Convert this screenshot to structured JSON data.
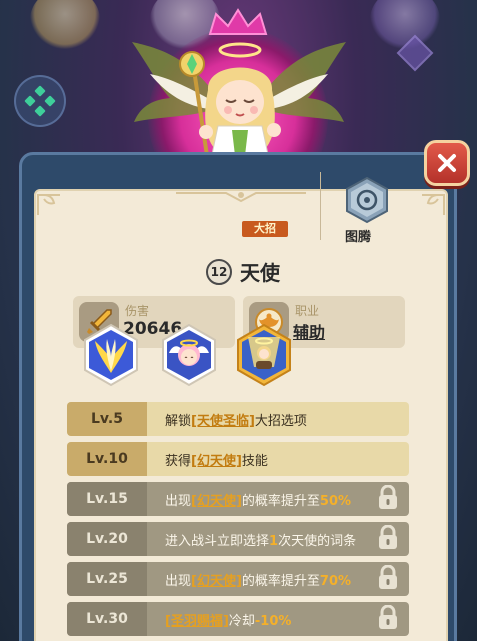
{
  "hero": {
    "level": "12",
    "name": "天使"
  },
  "stats": {
    "damage_label": "伤害",
    "damage_value": "20646",
    "job_label": "职业",
    "job_value": "辅助"
  },
  "skills": {
    "ult_tag": "大招",
    "totem_label": "图腾"
  },
  "levels": [
    {
      "lv": "Lv.5",
      "pre": "解锁",
      "hl": "[天使圣临]",
      "post": "大招选项",
      "num": "",
      "post2": "",
      "locked": false
    },
    {
      "lv": "Lv.10",
      "pre": "获得",
      "hl": "[幻天使]",
      "post": "技能",
      "num": "",
      "post2": "",
      "locked": false
    },
    {
      "lv": "Lv.15",
      "pre": "出现",
      "hl": "[幻天使]",
      "post": "的概率提升至",
      "num": "50%",
      "post2": "",
      "locked": true
    },
    {
      "lv": "Lv.20",
      "pre": "进入战斗立即选择",
      "hl": "",
      "post": "",
      "num": "1",
      "post2": "次天使的词条",
      "locked": true
    },
    {
      "lv": "Lv.25",
      "pre": "出现",
      "hl": "[幻天使]",
      "post": "的概率提升至",
      "num": "70%",
      "post2": "",
      "locked": true
    },
    {
      "lv": "Lv.30",
      "pre": "",
      "hl": "[圣羽赐福]",
      "post": "冷却",
      "num": "-10%",
      "post2": "",
      "locked": true
    }
  ],
  "colors": {
    "panel_bg": "#f3ead7",
    "frame": "#2e4a6a",
    "highlight": "#e6a020",
    "unlocked_row": "#e8d9a8",
    "locked_row": "#a09882"
  }
}
